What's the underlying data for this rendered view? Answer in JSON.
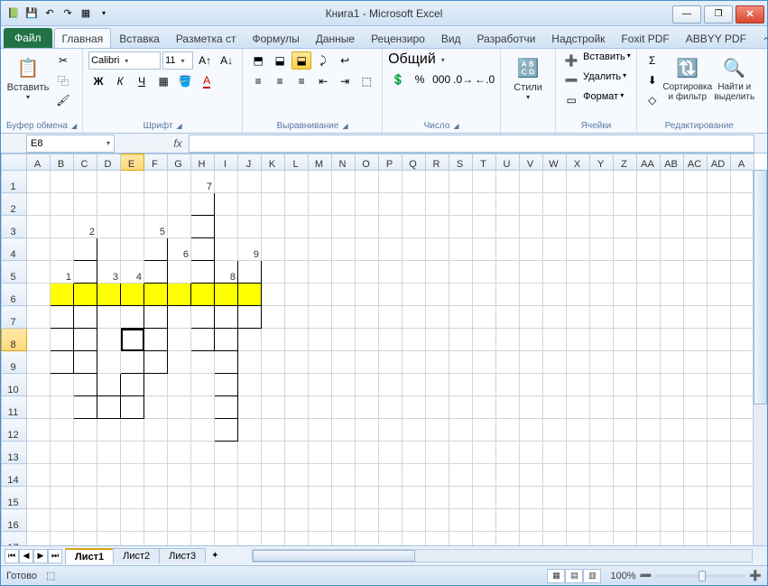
{
  "title": "Книга1  -  Microsoft Excel",
  "tabs": {
    "file": "Файл",
    "items": [
      "Главная",
      "Вставка",
      "Разметка ст",
      "Формулы",
      "Данные",
      "Рецензиро",
      "Вид",
      "Разработчи",
      "Надстройк",
      "Foxit PDF",
      "ABBYY PDF"
    ],
    "active": 0
  },
  "ribbon": {
    "clipboard": {
      "paste": "Вставить",
      "label": "Буфер обмена"
    },
    "font": {
      "name": "Calibri",
      "size": "11",
      "label": "Шрифт",
      "bold": "Ж",
      "italic": "К",
      "underline": "Ч"
    },
    "align": {
      "label": "Выравнивание"
    },
    "number": {
      "format": "Общий",
      "label": "Число"
    },
    "styles": {
      "btn": "Стили"
    },
    "cells": {
      "insert": "Вставить",
      "delete": "Удалить",
      "format": "Формат",
      "label": "Ячейки"
    },
    "editing": {
      "sort": "Сортировка и фильтр",
      "find": "Найти и выделить",
      "label": "Редактирование"
    }
  },
  "namebox": "E8",
  "columns": [
    "A",
    "B",
    "C",
    "D",
    "E",
    "F",
    "G",
    "H",
    "I",
    "J",
    "K",
    "L",
    "M",
    "N",
    "O",
    "P",
    "Q",
    "R",
    "S",
    "T",
    "U",
    "V",
    "W",
    "X",
    "Y",
    "Z",
    "AA",
    "AB",
    "AC",
    "AD",
    "A"
  ],
  "rows": [
    "1",
    "2",
    "3",
    "4",
    "5",
    "6",
    "7",
    "8",
    "9",
    "10",
    "11",
    "12",
    "13",
    "14",
    "15",
    "16",
    "17"
  ],
  "crossword": {
    "numbers": {
      "H1": "7",
      "C3": "2",
      "F3": "5",
      "G4": "6",
      "J4": "9",
      "B5": "1",
      "D5": "3",
      "E5": "4",
      "I5": "8"
    },
    "bordered": [
      "H2",
      "H3",
      "C4",
      "F4",
      "H4",
      "B6",
      "C6",
      "D6",
      "E6",
      "F6",
      "G6",
      "H6",
      "I6",
      "J6",
      "C5",
      "F5",
      "H5",
      "I5",
      "J5",
      "B7",
      "C7",
      "E7",
      "F7",
      "H7",
      "I7",
      "J7",
      "B8",
      "C8",
      "E8",
      "F8",
      "H8",
      "I8",
      "B9",
      "C9",
      "E9",
      "F9",
      "I9",
      "C10",
      "D10",
      "E10",
      "I10",
      "C11",
      "D11",
      "E11",
      "I11",
      "I12"
    ],
    "yellowRow": [
      "B6",
      "C6",
      "D6",
      "E6",
      "F6",
      "G6",
      "H6",
      "I6",
      "J6"
    ]
  },
  "activeCell": "E8",
  "hiliteCol": "E",
  "hiliteRow": "8",
  "sheets": {
    "items": [
      "Лист1",
      "Лист2",
      "Лист3"
    ],
    "active": 0
  },
  "status": {
    "ready": "Готово",
    "zoom": "100%"
  }
}
